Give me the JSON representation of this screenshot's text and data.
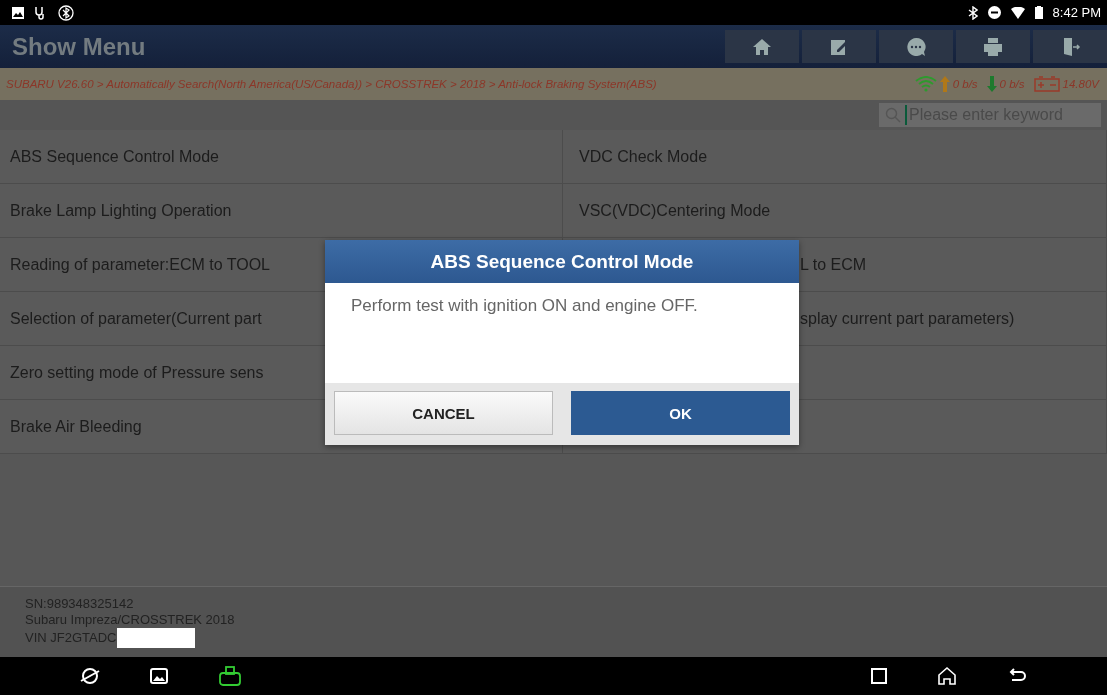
{
  "status_bar": {
    "time": "8:42 PM"
  },
  "header": {
    "title": "Show Menu"
  },
  "breadcrumb": {
    "path": "SUBARU V26.60 > Automatically Search(North America(US/Canada)) > CROSSTREK > 2018 > Anti-lock Braking System(ABS)",
    "upload": "0 b/s",
    "download": "0 b/s",
    "voltage": "14.80V"
  },
  "search": {
    "placeholder": "Please enter keyword"
  },
  "menu_rows": [
    {
      "left": "ABS Sequence Control Mode",
      "right": "VDC Check Mode"
    },
    {
      "left": "Brake Lamp Lighting Operation",
      "right": "VSC(VDC)Centering Mode"
    },
    {
      "left": "Reading of parameter:ECM to TOOL",
      "right": "L to ECM"
    },
    {
      "left": "Selection of parameter(Current part",
      "right": "splay current part parameters)"
    },
    {
      "left": "Zero setting mode of Pressure sens",
      "right": ""
    },
    {
      "left": "Brake Air Bleeding",
      "right": ""
    }
  ],
  "footer": {
    "lines": [
      "SN:989348325142",
      "Subaru Impreza/CROSSTREK 2018",
      "VIN JF2GTADC"
    ]
  },
  "dialog": {
    "title": "ABS Sequence Control Mode",
    "message": "Perform test with ignition ON and engine OFF.",
    "buttons": [
      {
        "label": "CANCEL",
        "kind": "secondary"
      },
      {
        "label": "OK",
        "kind": "primary"
      }
    ]
  }
}
